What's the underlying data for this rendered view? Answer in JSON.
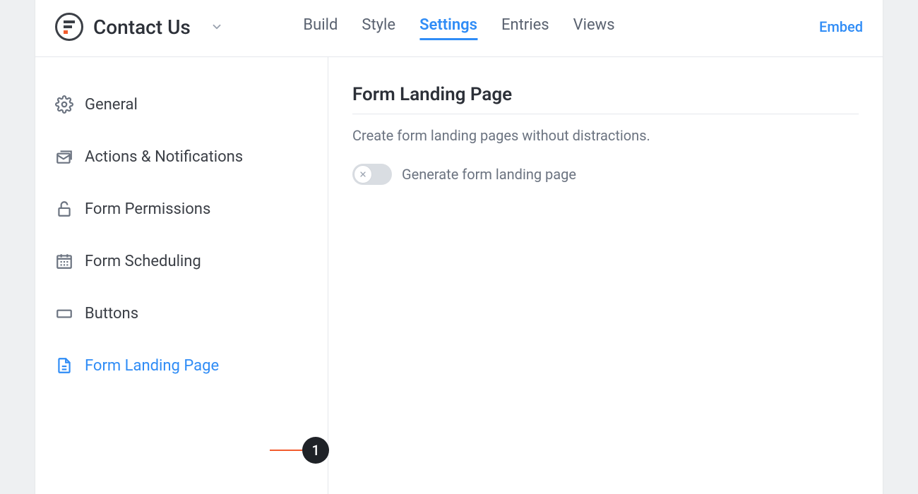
{
  "header": {
    "title": "Contact Us",
    "embed_label": "Embed"
  },
  "nav": {
    "items": [
      {
        "label": "Build",
        "active": false
      },
      {
        "label": "Style",
        "active": false
      },
      {
        "label": "Settings",
        "active": true
      },
      {
        "label": "Entries",
        "active": false
      },
      {
        "label": "Views",
        "active": false
      }
    ]
  },
  "sidebar": {
    "items": [
      {
        "label": "General",
        "icon": "gear-icon",
        "active": false
      },
      {
        "label": "Actions & Notifications",
        "icon": "mail-stack-icon",
        "active": false
      },
      {
        "label": "Form Permissions",
        "icon": "lock-icon",
        "active": false
      },
      {
        "label": "Form Scheduling",
        "icon": "calendar-icon",
        "active": false
      },
      {
        "label": "Buttons",
        "icon": "button-icon",
        "active": false
      },
      {
        "label": "Form Landing Page",
        "icon": "page-icon",
        "active": true
      }
    ]
  },
  "main": {
    "title": "Form Landing Page",
    "description": "Create form landing pages without distractions.",
    "toggle": {
      "label": "Generate form landing page",
      "on": false
    }
  },
  "callout": {
    "number": "1"
  }
}
